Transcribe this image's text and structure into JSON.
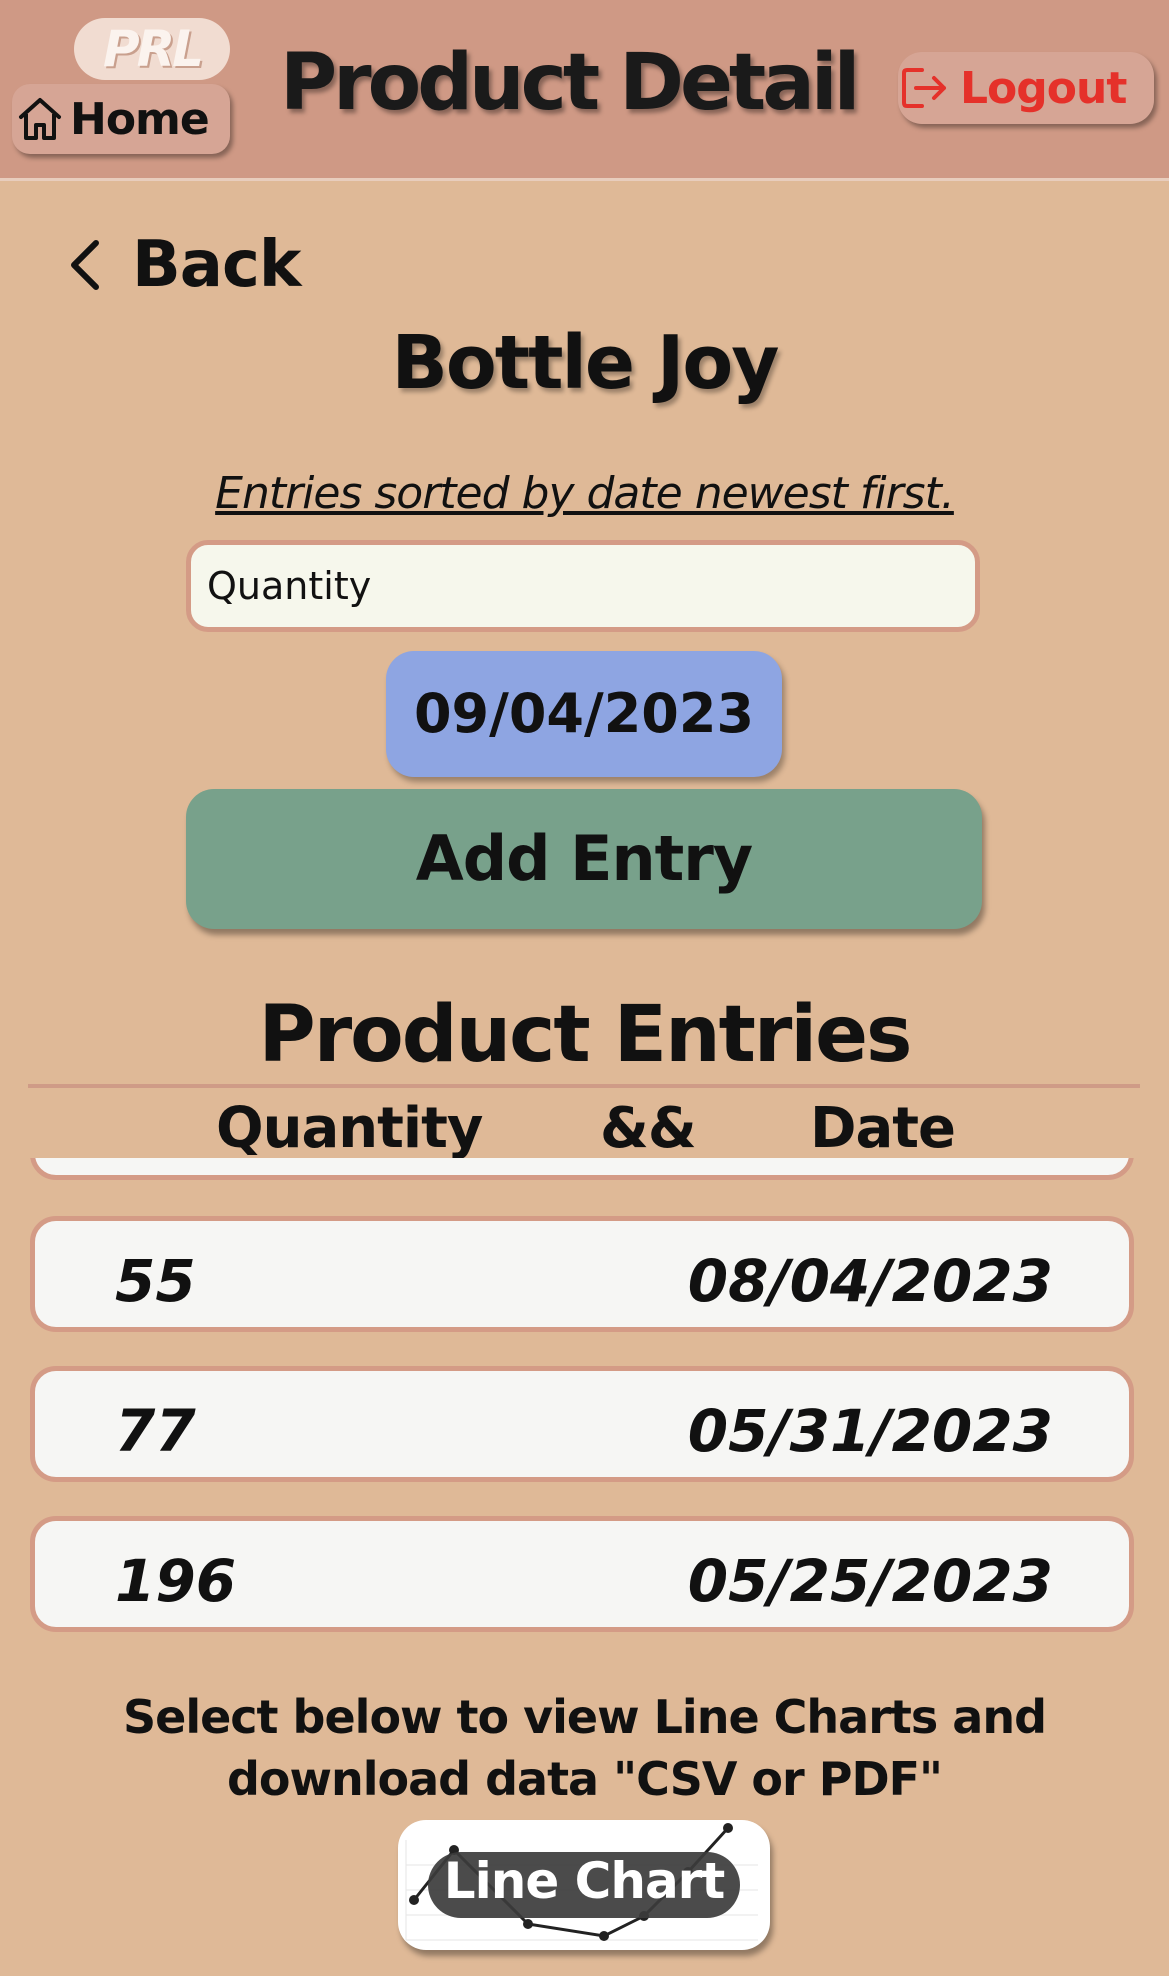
{
  "header": {
    "logo_text": "PRL",
    "home_label": "Home",
    "title": "Product Detail",
    "logout_label": "Logout"
  },
  "nav": {
    "back_label": "Back"
  },
  "product": {
    "name": "Bottle Joy"
  },
  "sort_note": "Entries sorted by date newest first.",
  "form": {
    "quantity_placeholder": "Quantity",
    "quantity_value": "",
    "date_value": "09/04/2023",
    "add_label": "Add Entry"
  },
  "entries": {
    "title": "Product Entries",
    "col_quantity": "Quantity",
    "col_sep": "&&",
    "col_date": "Date",
    "rows": [
      {
        "quantity": "55",
        "date": "08/04/2023"
      },
      {
        "quantity": "77",
        "date": "05/31/2023"
      },
      {
        "quantity": "196",
        "date": "05/25/2023"
      }
    ]
  },
  "hint_text": "Select below to view Line Charts and download data \"CSV or PDF\"",
  "chart_button": {
    "label": "Line Chart"
  },
  "colors": {
    "background": "#dfb997",
    "header": "#cf9985",
    "date_button": "#8ea5e2",
    "add_button": "#78a18b",
    "logout": "#e5312a"
  }
}
